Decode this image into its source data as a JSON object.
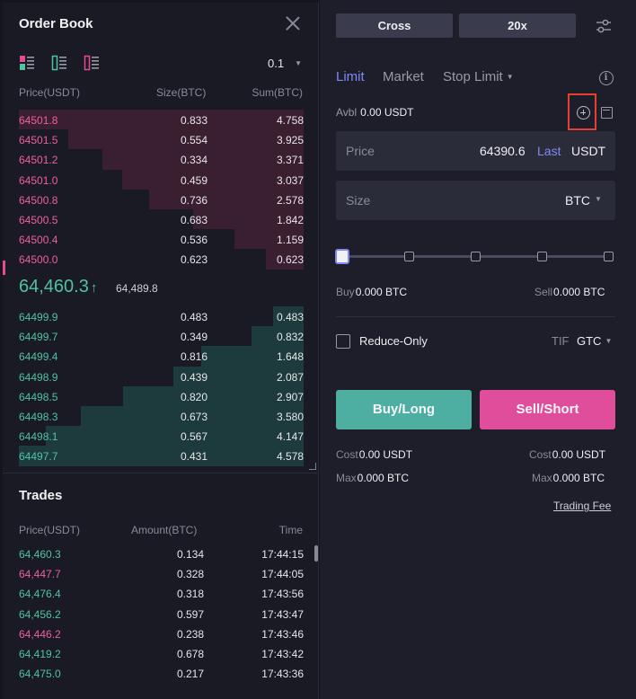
{
  "order_book": {
    "title": "Order Book",
    "tick_size": "0.1",
    "columns": {
      "price": "Price(USDT)",
      "size": "Size(BTC)",
      "sum": "Sum(BTC)"
    },
    "asks": [
      {
        "price": "64501.8",
        "size": "0.833",
        "sum": "4.758",
        "depth": 1.0
      },
      {
        "price": "64501.5",
        "size": "0.554",
        "sum": "3.925",
        "depth": 0.825
      },
      {
        "price": "64501.2",
        "size": "0.334",
        "sum": "3.371",
        "depth": 0.708
      },
      {
        "price": "64501.0",
        "size": "0.459",
        "sum": "3.037",
        "depth": 0.638
      },
      {
        "price": "64500.8",
        "size": "0.736",
        "sum": "2.578",
        "depth": 0.542
      },
      {
        "price": "64500.5",
        "size": "0.683",
        "sum": "1.842",
        "depth": 0.387
      },
      {
        "price": "64500.4",
        "size": "0.536",
        "sum": "1.159",
        "depth": 0.244
      },
      {
        "price": "64500.0",
        "size": "0.623",
        "sum": "0.623",
        "depth": 0.131
      }
    ],
    "last_price": "64,460.3",
    "last_price_arrow": "↑",
    "mark_price": "64,489.8",
    "bids": [
      {
        "price": "64499.9",
        "size": "0.483",
        "sum": "0.483",
        "depth": 0.106
      },
      {
        "price": "64499.7",
        "size": "0.349",
        "sum": "0.832",
        "depth": 0.182
      },
      {
        "price": "64499.4",
        "size": "0.816",
        "sum": "1.648",
        "depth": 0.36
      },
      {
        "price": "64498.9",
        "size": "0.439",
        "sum": "2.087",
        "depth": 0.456
      },
      {
        "price": "64498.5",
        "size": "0.820",
        "sum": "2.907",
        "depth": 0.635
      },
      {
        "price": "64498.3",
        "size": "0.673",
        "sum": "3.580",
        "depth": 0.782
      },
      {
        "price": "64498.1",
        "size": "0.567",
        "sum": "4.147",
        "depth": 0.906
      },
      {
        "price": "64497.7",
        "size": "0.431",
        "sum": "4.578",
        "depth": 1.0
      }
    ]
  },
  "trades": {
    "title": "Trades",
    "columns": {
      "price": "Price(USDT)",
      "amount": "Amount(BTC)",
      "time": "Time"
    },
    "rows": [
      {
        "price": "64,460.3",
        "amount": "0.134",
        "time": "17:44:15",
        "side": "up"
      },
      {
        "price": "64,447.7",
        "amount": "0.328",
        "time": "17:44:05",
        "side": "down"
      },
      {
        "price": "64,476.4",
        "amount": "0.318",
        "time": "17:43:56",
        "side": "up"
      },
      {
        "price": "64,456.2",
        "amount": "0.597",
        "time": "17:43:47",
        "side": "up"
      },
      {
        "price": "64,446.2",
        "amount": "0.238",
        "time": "17:43:46",
        "side": "down"
      },
      {
        "price": "64,419.2",
        "amount": "0.678",
        "time": "17:43:42",
        "side": "up"
      },
      {
        "price": "64,475.0",
        "amount": "0.217",
        "time": "17:43:36",
        "side": "up"
      }
    ]
  },
  "order_form": {
    "margin_mode": "Cross",
    "leverage": "20x",
    "tabs": [
      "Limit",
      "Market",
      "Stop Limit"
    ],
    "active_tab": 0,
    "avbl_label": "Avbl",
    "avbl_value": "0.00 USDT",
    "price_label": "Price",
    "price_value": "64390.6",
    "last_label": "Last",
    "price_unit": "USDT",
    "size_label": "Size",
    "size_unit": "BTC",
    "slider_level": 0,
    "buy_label": "Buy",
    "buy_value": "0.000 BTC",
    "sell_label": "Sell",
    "sell_value": "0.000 BTC",
    "reduce_only_label": "Reduce-Only",
    "tif_label": "TIF",
    "tif_value": "GTC",
    "buy_button": "Buy/Long",
    "sell_button": "Sell/Short",
    "cost_label": "Cost",
    "cost_buy": "0.00 USDT",
    "cost_sell": "0.00 USDT",
    "max_label": "Max",
    "max_buy": "0.000 BTC",
    "max_sell": "0.000 BTC",
    "fee_link": "Trading Fee"
  },
  "colors": {
    "bid": "#4fc2a6",
    "ask": "#ee5fa0",
    "accent": "#7e8af2",
    "buy_button": "#4dafa2",
    "sell_button": "#df4d9b",
    "highlight": "#e8402e"
  },
  "icons": [
    "close-icon",
    "layout-both-icon",
    "layout-bids-icon",
    "layout-asks-icon",
    "adjust-icon",
    "info-icon",
    "plus-circle-icon",
    "calculator-icon"
  ]
}
